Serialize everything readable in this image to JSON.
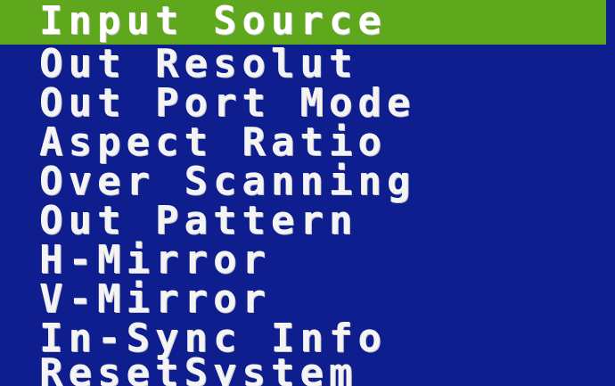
{
  "osd_menu": {
    "selected_color": "#5fa71c",
    "background_color": "#0e1e8e",
    "text_color": "#f4f4f4",
    "items": [
      {
        "label": "Input Source"
      },
      {
        "label": "Out Resolut"
      },
      {
        "label": "Out Port Mode"
      },
      {
        "label": "Aspect Ratio"
      },
      {
        "label": "Over Scanning"
      },
      {
        "label": "Out Pattern"
      },
      {
        "label": "H-Mirror"
      },
      {
        "label": "V-Mirror"
      },
      {
        "label": "In-Sync Info"
      },
      {
        "label": "ResetSystem"
      }
    ]
  }
}
